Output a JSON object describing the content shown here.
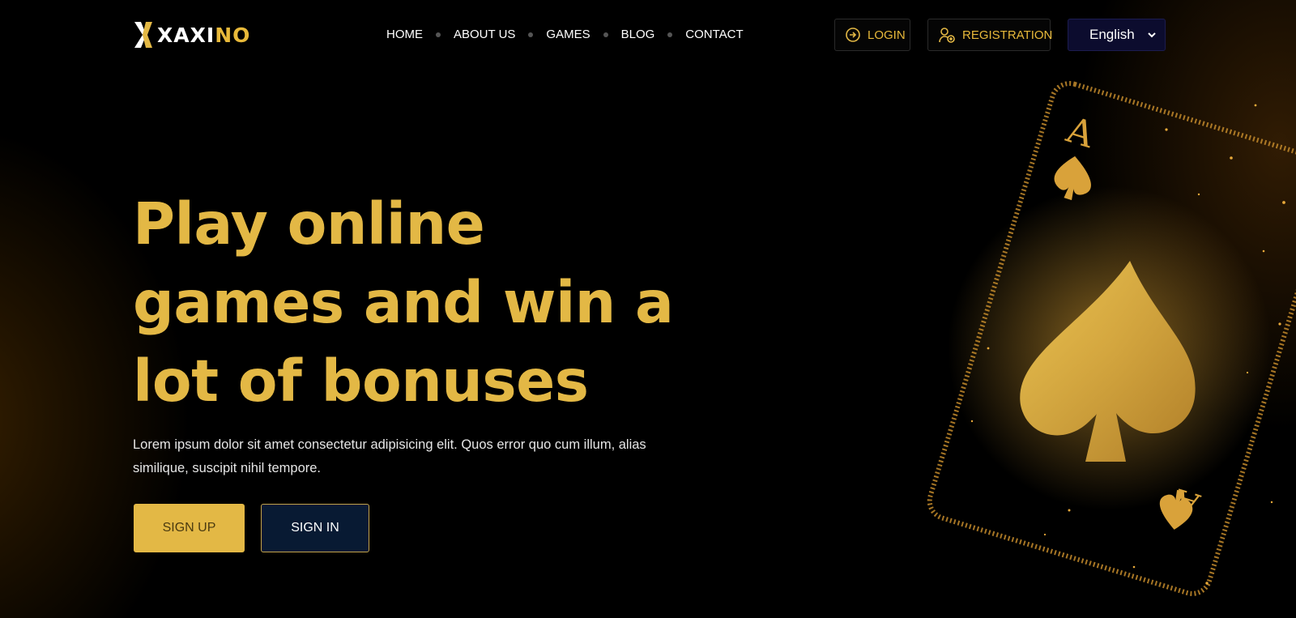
{
  "brand": {
    "logo_white": "XAXI",
    "logo_gold": "NO",
    "accent": "#e3b845",
    "bg": "#000000"
  },
  "nav": {
    "items": [
      {
        "label": "HOME"
      },
      {
        "label": "ABOUT US"
      },
      {
        "label": "GAMES"
      },
      {
        "label": "BLOG"
      },
      {
        "label": "CONTACT"
      }
    ]
  },
  "header_actions": {
    "login_label": "LOGIN",
    "login_icon": "login-icon",
    "registration_label": "REGISTRATION",
    "registration_icon": "user-add-icon",
    "language_selected": "English"
  },
  "hero": {
    "title": "Play online games and win a lot of bonuses",
    "subtitle": "Lorem ipsum dolor sit amet consectetur adipisicing elit. Quos error quo cum illum, alias similique, suscipit nihil tempore.",
    "signup_label": "SIGN UP",
    "signin_label": "SIGN IN"
  },
  "decor": {
    "art": "ace-of-spades-card"
  }
}
